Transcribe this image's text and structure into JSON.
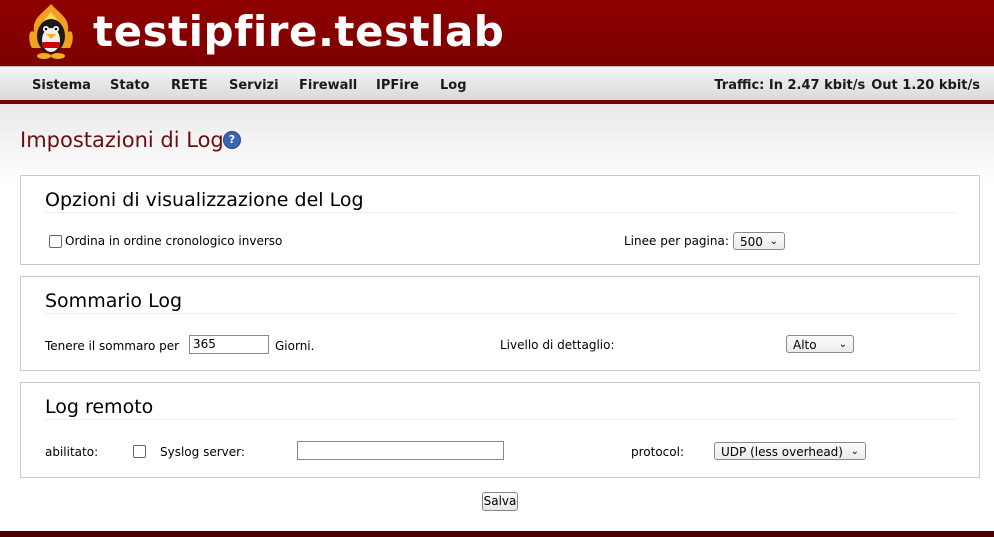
{
  "header": {
    "title": "testipfire.testlab",
    "logo_icon": "ipfire-penguin-flame-logo"
  },
  "nav": {
    "items": [
      "Sistema",
      "Stato",
      "RETE",
      "Servizi",
      "Firewall",
      "IPFire",
      "Log"
    ],
    "traffic_in": "Traffic: In 2.47 kbit/s",
    "traffic_out": "Out 1.20 kbit/s"
  },
  "page": {
    "title": "Impostazioni di Log",
    "help_icon": "help-icon"
  },
  "display_options": {
    "title": "Opzioni di visualizzazione del Log",
    "reverse_label": "Ordina in ordine cronologico inverso",
    "reverse_checked": false,
    "lines_label": "Linee per pagina:",
    "lines_value": "500"
  },
  "summary": {
    "title": "Sommario Log",
    "keep_label": "Tenere il sommaro per",
    "keep_value": "365",
    "days_label": "Giorni.",
    "detail_label": "Livello di dettaglio:",
    "detail_value": "Alto"
  },
  "remote": {
    "title": "Log remoto",
    "enabled_label": "abilitato:",
    "enabled_checked": false,
    "server_label": "Syslog server:",
    "server_value": "",
    "protocol_label": "protocol:",
    "protocol_value": "UDP (less overhead)"
  },
  "actions": {
    "save_label": "Salva"
  }
}
